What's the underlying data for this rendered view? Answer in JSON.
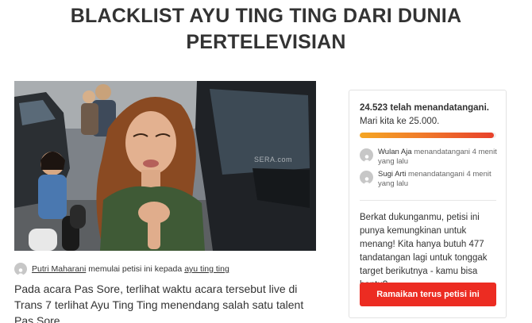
{
  "petition": {
    "title_line1": "BLACKLIST AYU TING TING DARI DUNIA",
    "title_line2": "PERTELEVISIAN",
    "image_watermark": "SERA.com",
    "starter_name": "Putri Maharani",
    "starter_action": "memulai petisi ini kepada",
    "target_name": "ayu ting ting",
    "description": "Pada acara Pas Sore, terlihat waktu acara tersebut live di Trans 7 terlihat Ayu Ting Ting menendang salah satu talent Pas Sore."
  },
  "sidebar": {
    "count_bold": "24.523 telah menandatangani.",
    "count_rest": " Mari kita ke 25.000.",
    "progress_fraction": 0.981,
    "signers": [
      {
        "name": "Wulan Aja",
        "action": " menandatangani 4 menit yang lalu"
      },
      {
        "name": "Sugi Arti",
        "action": " menandatangani 4 menit yang lalu"
      }
    ],
    "motivation": "Berkat dukunganmu, petisi ini punya kemungkinan untuk menang! Kita hanya butuh 477 tandatangan lagi untuk tonggak target berikutnya - kamu bisa bantu?",
    "cta_label": "Ramaikan terus petisi ini"
  },
  "colors": {
    "cta": "#ec2c22",
    "progress_start": "#f5a623",
    "progress_end": "#e8412b"
  }
}
